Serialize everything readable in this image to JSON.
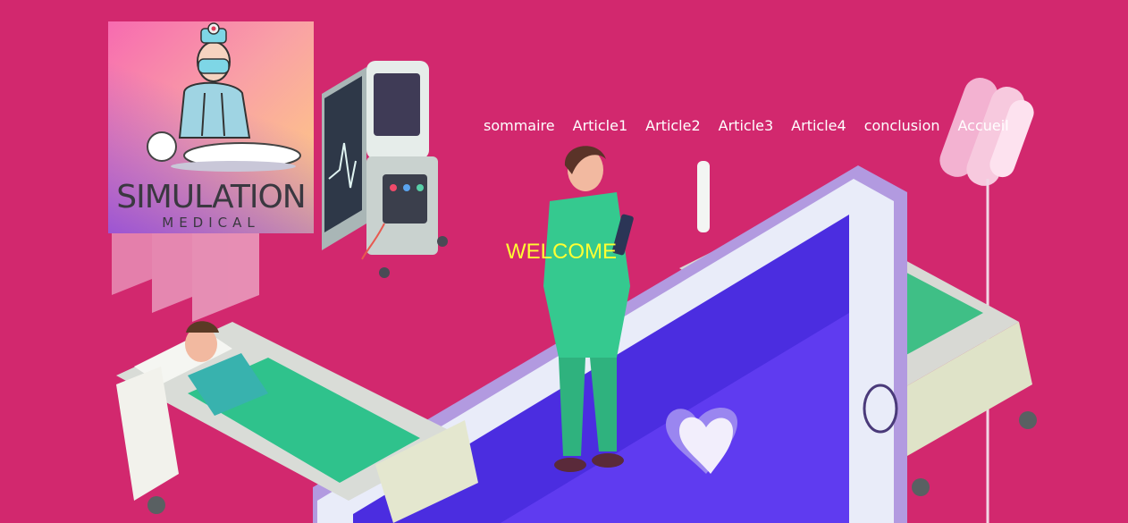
{
  "logo": {
    "title": "SIMULATION",
    "subtitle": "MEDICAL"
  },
  "nav": {
    "items": [
      {
        "label": "sommaire"
      },
      {
        "label": "Article1"
      },
      {
        "label": "Article2"
      },
      {
        "label": "Article3"
      },
      {
        "label": "Article4"
      },
      {
        "label": "conclusion"
      },
      {
        "label": "Accueil"
      }
    ]
  },
  "hero": {
    "welcome": "WELCOME"
  },
  "colors": {
    "background": "#d2286e",
    "nav_text": "#ffffff",
    "welcome_text": "#ffff33"
  },
  "icons": [
    "medical-mascot-icon",
    "ventilator-icon",
    "hospital-bed-icon",
    "doctor-figure-icon",
    "tablet-screen-icon",
    "iv-bag-icon",
    "heart-icon"
  ]
}
